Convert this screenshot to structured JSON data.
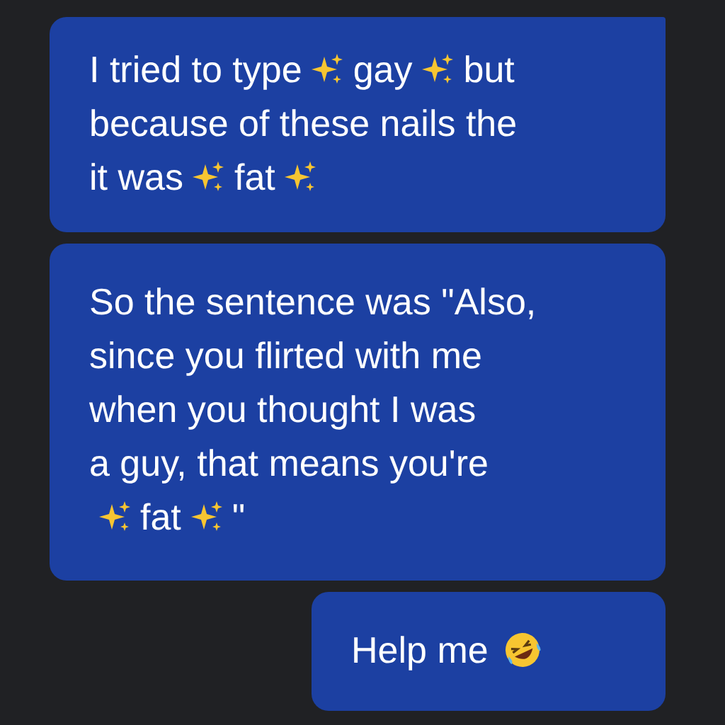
{
  "messages": [
    {
      "lines": [
        [
          {
            "kind": "text",
            "text": "I tried to type"
          },
          {
            "kind": "sparkle"
          },
          {
            "kind": "text",
            "text": "gay"
          },
          {
            "kind": "sparkle"
          },
          {
            "kind": "text",
            "text": "but"
          }
        ],
        [
          {
            "kind": "text",
            "text": "because of these nails the"
          }
        ],
        [
          {
            "kind": "text",
            "text": "it was"
          },
          {
            "kind": "sparkle"
          },
          {
            "kind": "text",
            "text": "fat"
          },
          {
            "kind": "sparkle"
          }
        ]
      ]
    },
    {
      "lines": [
        [
          {
            "kind": "text",
            "text": "So the sentence was \"Also,"
          }
        ],
        [
          {
            "kind": "text",
            "text": "since you flirted with me"
          }
        ],
        [
          {
            "kind": "text",
            "text": "when you thought I was"
          }
        ],
        [
          {
            "kind": "text",
            "text": "a guy, that means you're"
          }
        ],
        [
          {
            "kind": "sparkle"
          },
          {
            "kind": "text",
            "text": "fat"
          },
          {
            "kind": "sparkle"
          },
          {
            "kind": "text",
            "text": "\""
          }
        ]
      ]
    },
    {
      "lines": [
        [
          {
            "kind": "text",
            "text": "Help me"
          },
          {
            "kind": "laugh"
          }
        ]
      ]
    }
  ]
}
